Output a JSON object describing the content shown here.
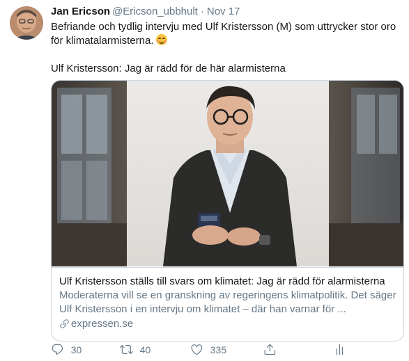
{
  "author": {
    "name": "Jan Ericson",
    "handle": "@Ericson_ubbhult",
    "separator": "·",
    "date": "Nov 17"
  },
  "tweet": {
    "line1": "Befriande och tydlig intervju med Ulf Kristersson (M) som uttrycker stor oro för klimatalarmisterna.",
    "emoji": "smiling-face-emoji",
    "line2": "Ulf Kristersson: Jag är rädd för de här alarmisterna"
  },
  "card": {
    "title": "Ulf Kristersson ställs till svars om klimatet: Jag är rädd för alarmisterna",
    "description": "Moderaterna vill se en granskning av regeringens klimatpolitik. Det säger Ulf Kristersson i en intervju om klimatet – där han varnar för ...",
    "domain": "expressen.se"
  },
  "actions": {
    "reply_count": "30",
    "retweet_count": "40",
    "like_count": "335"
  },
  "colors": {
    "text_primary": "#14171a",
    "text_secondary": "#657786",
    "border": "#ccd6dd"
  }
}
